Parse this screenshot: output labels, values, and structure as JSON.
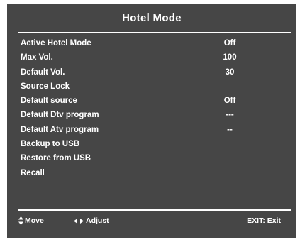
{
  "menu": {
    "title": "Hotel Mode",
    "items": [
      {
        "label": "Active Hotel Mode",
        "value": "Off"
      },
      {
        "label": "Max Vol.",
        "value": "100"
      },
      {
        "label": "Default Vol.",
        "value": "30"
      },
      {
        "label": "Source Lock",
        "value": ""
      },
      {
        "label": "Default source",
        "value": "Off"
      },
      {
        "label": "Default Dtv program",
        "value": "---"
      },
      {
        "label": "Default Atv program",
        "value": "--"
      },
      {
        "label": "Backup to USB",
        "value": ""
      },
      {
        "label": "Restore from USB",
        "value": ""
      },
      {
        "label": "Recall",
        "value": ""
      }
    ]
  },
  "footer": {
    "move_label": "Move",
    "move_icon": "up-down-arrows-icon",
    "adjust_label": "Adjust",
    "adjust_icon": "left-right-arrows-icon",
    "exit_label": "EXIT: Exit"
  },
  "colors": {
    "panel_background": "#464646",
    "text": "#ffffff",
    "divider": "#ffffff"
  }
}
